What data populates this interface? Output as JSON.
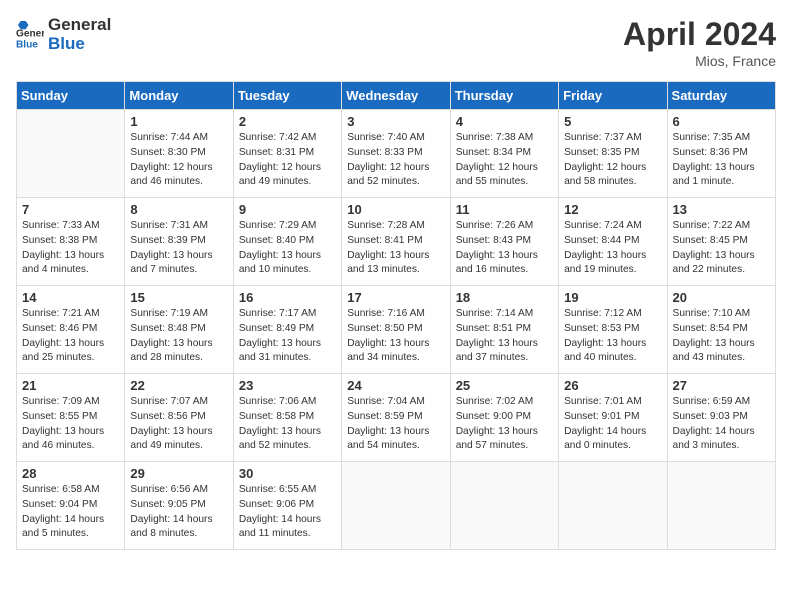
{
  "header": {
    "logo_general": "General",
    "logo_blue": "Blue",
    "month_year": "April 2024",
    "location": "Mios, France"
  },
  "days_of_week": [
    "Sunday",
    "Monday",
    "Tuesday",
    "Wednesday",
    "Thursday",
    "Friday",
    "Saturday"
  ],
  "weeks": [
    [
      {
        "day": "",
        "sunrise": "",
        "sunset": "",
        "daylight": ""
      },
      {
        "day": "1",
        "sunrise": "Sunrise: 7:44 AM",
        "sunset": "Sunset: 8:30 PM",
        "daylight": "Daylight: 12 hours and 46 minutes."
      },
      {
        "day": "2",
        "sunrise": "Sunrise: 7:42 AM",
        "sunset": "Sunset: 8:31 PM",
        "daylight": "Daylight: 12 hours and 49 minutes."
      },
      {
        "day": "3",
        "sunrise": "Sunrise: 7:40 AM",
        "sunset": "Sunset: 8:33 PM",
        "daylight": "Daylight: 12 hours and 52 minutes."
      },
      {
        "day": "4",
        "sunrise": "Sunrise: 7:38 AM",
        "sunset": "Sunset: 8:34 PM",
        "daylight": "Daylight: 12 hours and 55 minutes."
      },
      {
        "day": "5",
        "sunrise": "Sunrise: 7:37 AM",
        "sunset": "Sunset: 8:35 PM",
        "daylight": "Daylight: 12 hours and 58 minutes."
      },
      {
        "day": "6",
        "sunrise": "Sunrise: 7:35 AM",
        "sunset": "Sunset: 8:36 PM",
        "daylight": "Daylight: 13 hours and 1 minute."
      }
    ],
    [
      {
        "day": "7",
        "sunrise": "Sunrise: 7:33 AM",
        "sunset": "Sunset: 8:38 PM",
        "daylight": "Daylight: 13 hours and 4 minutes."
      },
      {
        "day": "8",
        "sunrise": "Sunrise: 7:31 AM",
        "sunset": "Sunset: 8:39 PM",
        "daylight": "Daylight: 13 hours and 7 minutes."
      },
      {
        "day": "9",
        "sunrise": "Sunrise: 7:29 AM",
        "sunset": "Sunset: 8:40 PM",
        "daylight": "Daylight: 13 hours and 10 minutes."
      },
      {
        "day": "10",
        "sunrise": "Sunrise: 7:28 AM",
        "sunset": "Sunset: 8:41 PM",
        "daylight": "Daylight: 13 hours and 13 minutes."
      },
      {
        "day": "11",
        "sunrise": "Sunrise: 7:26 AM",
        "sunset": "Sunset: 8:43 PM",
        "daylight": "Daylight: 13 hours and 16 minutes."
      },
      {
        "day": "12",
        "sunrise": "Sunrise: 7:24 AM",
        "sunset": "Sunset: 8:44 PM",
        "daylight": "Daylight: 13 hours and 19 minutes."
      },
      {
        "day": "13",
        "sunrise": "Sunrise: 7:22 AM",
        "sunset": "Sunset: 8:45 PM",
        "daylight": "Daylight: 13 hours and 22 minutes."
      }
    ],
    [
      {
        "day": "14",
        "sunrise": "Sunrise: 7:21 AM",
        "sunset": "Sunset: 8:46 PM",
        "daylight": "Daylight: 13 hours and 25 minutes."
      },
      {
        "day": "15",
        "sunrise": "Sunrise: 7:19 AM",
        "sunset": "Sunset: 8:48 PM",
        "daylight": "Daylight: 13 hours and 28 minutes."
      },
      {
        "day": "16",
        "sunrise": "Sunrise: 7:17 AM",
        "sunset": "Sunset: 8:49 PM",
        "daylight": "Daylight: 13 hours and 31 minutes."
      },
      {
        "day": "17",
        "sunrise": "Sunrise: 7:16 AM",
        "sunset": "Sunset: 8:50 PM",
        "daylight": "Daylight: 13 hours and 34 minutes."
      },
      {
        "day": "18",
        "sunrise": "Sunrise: 7:14 AM",
        "sunset": "Sunset: 8:51 PM",
        "daylight": "Daylight: 13 hours and 37 minutes."
      },
      {
        "day": "19",
        "sunrise": "Sunrise: 7:12 AM",
        "sunset": "Sunset: 8:53 PM",
        "daylight": "Daylight: 13 hours and 40 minutes."
      },
      {
        "day": "20",
        "sunrise": "Sunrise: 7:10 AM",
        "sunset": "Sunset: 8:54 PM",
        "daylight": "Daylight: 13 hours and 43 minutes."
      }
    ],
    [
      {
        "day": "21",
        "sunrise": "Sunrise: 7:09 AM",
        "sunset": "Sunset: 8:55 PM",
        "daylight": "Daylight: 13 hours and 46 minutes."
      },
      {
        "day": "22",
        "sunrise": "Sunrise: 7:07 AM",
        "sunset": "Sunset: 8:56 PM",
        "daylight": "Daylight: 13 hours and 49 minutes."
      },
      {
        "day": "23",
        "sunrise": "Sunrise: 7:06 AM",
        "sunset": "Sunset: 8:58 PM",
        "daylight": "Daylight: 13 hours and 52 minutes."
      },
      {
        "day": "24",
        "sunrise": "Sunrise: 7:04 AM",
        "sunset": "Sunset: 8:59 PM",
        "daylight": "Daylight: 13 hours and 54 minutes."
      },
      {
        "day": "25",
        "sunrise": "Sunrise: 7:02 AM",
        "sunset": "Sunset: 9:00 PM",
        "daylight": "Daylight: 13 hours and 57 minutes."
      },
      {
        "day": "26",
        "sunrise": "Sunrise: 7:01 AM",
        "sunset": "Sunset: 9:01 PM",
        "daylight": "Daylight: 14 hours and 0 minutes."
      },
      {
        "day": "27",
        "sunrise": "Sunrise: 6:59 AM",
        "sunset": "Sunset: 9:03 PM",
        "daylight": "Daylight: 14 hours and 3 minutes."
      }
    ],
    [
      {
        "day": "28",
        "sunrise": "Sunrise: 6:58 AM",
        "sunset": "Sunset: 9:04 PM",
        "daylight": "Daylight: 14 hours and 5 minutes."
      },
      {
        "day": "29",
        "sunrise": "Sunrise: 6:56 AM",
        "sunset": "Sunset: 9:05 PM",
        "daylight": "Daylight: 14 hours and 8 minutes."
      },
      {
        "day": "30",
        "sunrise": "Sunrise: 6:55 AM",
        "sunset": "Sunset: 9:06 PM",
        "daylight": "Daylight: 14 hours and 11 minutes."
      },
      {
        "day": "",
        "sunrise": "",
        "sunset": "",
        "daylight": ""
      },
      {
        "day": "",
        "sunrise": "",
        "sunset": "",
        "daylight": ""
      },
      {
        "day": "",
        "sunrise": "",
        "sunset": "",
        "daylight": ""
      },
      {
        "day": "",
        "sunrise": "",
        "sunset": "",
        "daylight": ""
      }
    ]
  ]
}
